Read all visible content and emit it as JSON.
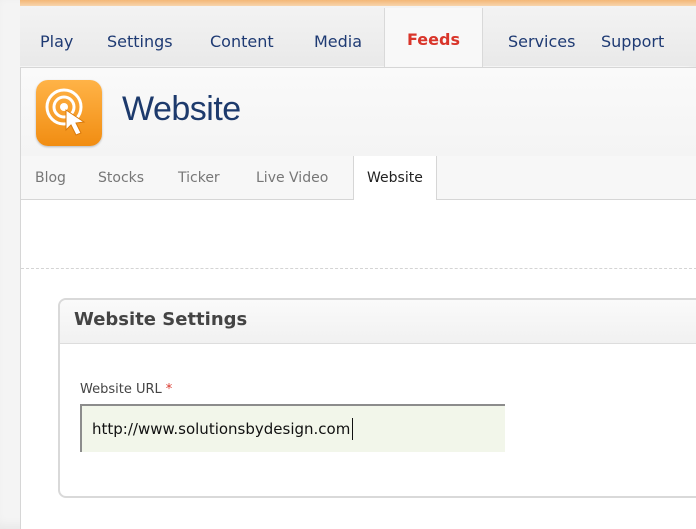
{
  "nav": {
    "items": [
      {
        "label": "Play"
      },
      {
        "label": "Settings"
      },
      {
        "label": "Content"
      },
      {
        "label": "Media"
      },
      {
        "label": "Feeds",
        "active": true
      },
      {
        "label": "Services"
      },
      {
        "label": "Support"
      }
    ]
  },
  "header": {
    "icon": "touch-icon",
    "title": "Website"
  },
  "subtabs": {
    "items": [
      {
        "label": "Blog"
      },
      {
        "label": "Stocks"
      },
      {
        "label": "Ticker"
      },
      {
        "label": "Live Video"
      },
      {
        "label": "Website",
        "active": true
      }
    ]
  },
  "settings": {
    "title": "Website Settings",
    "url_label": "Website URL",
    "required_mark": "*",
    "url_value": "http://www.solutionsbydesign.com"
  },
  "colors": {
    "accent": "#f18d12",
    "active_nav": "#d9352a",
    "link": "#1e3a73",
    "input_bg": "#f2f6ea"
  }
}
